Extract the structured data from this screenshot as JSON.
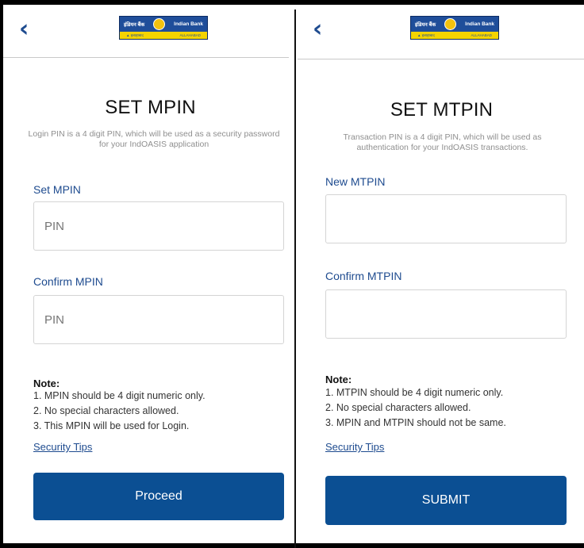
{
  "left": {
    "logo_hindi": "इंडियन बैंक",
    "logo_english": "Indian Bank",
    "logo_sub_left": "▲ इलाहाबाद",
    "logo_sub_right": "ALLAHABAD",
    "title": "SET MPIN",
    "description": "Login PIN is a 4 digit PIN, which will be used as a security password for your IndOASIS application",
    "field1_label": "Set MPIN",
    "field1_placeholder": "PIN",
    "field2_label": "Confirm MPIN",
    "field2_placeholder": "PIN",
    "note_title": "Note:",
    "notes": [
      "1. MPIN should be 4 digit numeric only.",
      "2. No special characters allowed.",
      "3. This MPIN will be used for Login."
    ],
    "security_tips": "Security Tips",
    "button": "Proceed"
  },
  "right": {
    "logo_hindi": "इंडियन बैंक",
    "logo_english": "Indian Bank",
    "logo_sub_left": "▲ इलाहाबाद",
    "logo_sub_right": "ALLAHABAD",
    "title": "SET MTPIN",
    "description": "Transaction PIN is a 4 digit PIN, which will be used as authentication for your IndOASIS transactions.",
    "field1_label": "New MTPIN",
    "field2_label": "Confirm MTPIN",
    "note_title": "Note:",
    "notes": [
      "1. MTPIN should be 4 digit numeric only.",
      "2. No special characters allowed.",
      "3. MPIN and MTPIN should not be same."
    ],
    "security_tips": "Security Tips",
    "button": "SUBMIT"
  },
  "icons": {
    "back": "chevron-left-icon"
  },
  "colors": {
    "primary": "#0b4f93",
    "link": "#1e4b8f"
  }
}
